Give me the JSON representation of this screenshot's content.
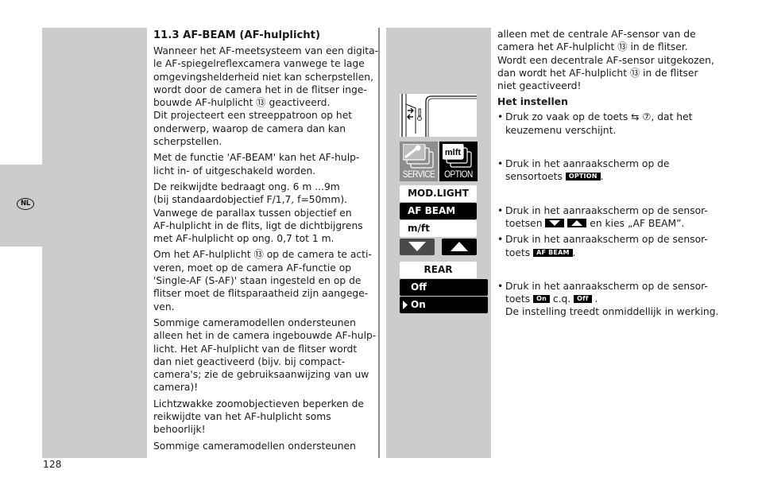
{
  "sidebar": {
    "language_badge": "NL"
  },
  "page_number": "128",
  "left_column": {
    "heading": "11.3 AF-BEAM (AF-hulplicht)",
    "paragraphs": [
      {
        "lines": [
          "Wanneer het AF-meetsysteem van een digita-",
          "le AF-spiegelreflexcamera vanwege te lage",
          "omgevingshelderheid niet kan scherpstellen,",
          "wordt door de camera het in de flitser inge-",
          "bouwde AF-hulplicht ⑬ geactiveerd.",
          "Dit projecteert een streeppatroon op het",
          "onderwerp, waarop de camera dan kan",
          "scherpstellen."
        ]
      },
      {
        "lines": [
          "Met de functie 'AF-BEAM' kan het AF-hulp-",
          "licht in- of uitgeschakeld worden."
        ]
      },
      {
        "lines": [
          "De reikwijdte bedraagt ong. 6 m ...9m",
          "(bij standaardobjectief F/1,7, f=50mm).",
          "Vanwege de parallax tussen objectief en",
          "AF-hulplicht in de flits, ligt de dichtbijgrens",
          "met AF-hulplicht op ong. 0,7 tot 1 m."
        ]
      },
      {
        "lines": [
          "Om het AF-hulplicht ⑬ op de camera te acti-",
          "veren, moet op de camera AF-functie op",
          "'Single-AF (S-AF)' staan ingesteld en op de",
          "flitser moet de flitsparaatheid zijn aangege-",
          "ven."
        ]
      },
      {
        "lines": [
          "Sommige cameramodellen  ondersteunen",
          "alleen het in de camera ingebouwde AF-hulp-",
          "licht. Het AF-hulplicht van de flitser wordt",
          "dan niet geactiveerd (bijv. bij compact-",
          "camera's; zie de gebruiksaanwijzing van uw",
          "camera)!"
        ]
      },
      {
        "lines": [
          "Lichtzwakke zoomobjectieven beperken de",
          "reikwijdte van het AF-hulplicht soms",
          "behoorlijk!"
        ]
      },
      {
        "lines": [
          "Sommige cameramodellen ondersteunen"
        ]
      }
    ]
  },
  "right_column": {
    "intro_lines": [
      "alleen met de centrale AF-sensor van de",
      "camera het AF-hulplicht ⑬ in de flitser.",
      "Wordt een decentrale AF-sensor uitgekozen,",
      "dan wordt het AF-hulplicht ⑬ in de flitser",
      "niet geactiveerd!"
    ],
    "subheading": "Het instellen",
    "steps": {
      "step1": {
        "line1": "Druk zo vaak op de toets ⇆ ⑦, dat het",
        "line2": "keuzemenu verschijnt."
      },
      "step2": {
        "line1": "Druk in het aanraakscherm op de",
        "line2_pre": "sensortoets ",
        "chip": "OPTION",
        "line2_post": "."
      },
      "step3": {
        "line1": "Druk in het aanraakscherm op de sensor-",
        "line2_pre": "toetsen ",
        "line2_post": " en kies  „AF BEAM”."
      },
      "step4": {
        "line1": "Druk in het aanraakscherm op de sensor-",
        "line2_pre": "toets ",
        "chip": "AF BEAM",
        "line2_post": "."
      },
      "step5": {
        "line1": "Druk in het aanraakscherm op de sensor-",
        "line2_pre": "toets ",
        "chip_on": "On",
        "line2_mid": " c.q. ",
        "chip_off": "Off",
        "line2_post": " .",
        "line3": "De instelling treedt onmiddellijk in werking."
      }
    }
  },
  "device_ui": {
    "tiles": {
      "service": "SERVICE",
      "option": "OPTION",
      "option_icon_text": "mlft"
    },
    "menu": {
      "mod_light": "MOD.LIGHT",
      "af_beam": "AF BEAM",
      "mft": "m/ft"
    },
    "rear": {
      "title": "REAR",
      "off": "Off",
      "on": "On",
      "selected": "On"
    }
  },
  "colors": {
    "panel_gray": "#cccccc",
    "divider": "#8a8a8a",
    "button_black": "#000000",
    "service_tile": "#8e8e8e",
    "down_button": "#4a4a4a"
  }
}
